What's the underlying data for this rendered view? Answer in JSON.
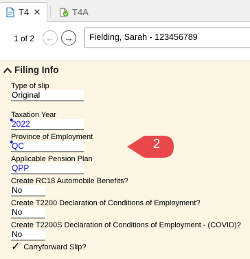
{
  "tabs": [
    {
      "label": "T4",
      "close": "✕",
      "active": true
    },
    {
      "label": "T4A",
      "active": false
    }
  ],
  "nav": {
    "pager": "1 of 2",
    "selector_value": "Fielding, Sarah - 123456789"
  },
  "panel": {
    "title": "Filing Info",
    "fields": [
      {
        "label": "Type of slip",
        "value": "Original"
      },
      {
        "label": "Taxation Year",
        "value": "2022"
      },
      {
        "label": "Province of Employment",
        "value": "QC"
      },
      {
        "label": "Applicable Pension Plan",
        "value": "QPP"
      },
      {
        "label": "Create RC18 Automobile Benefits?",
        "value": "No"
      },
      {
        "label": "Create T2200 Declaration of Conditions of Employment?",
        "value": "No"
      },
      {
        "label": "Create T2200S Declaration of Conditions of Employment - (COVID)?",
        "value": "No"
      }
    ],
    "checkbox": {
      "label": "Carryforward Slip?",
      "checked": true
    }
  },
  "callout": {
    "number": "2",
    "color": "#e8474b"
  },
  "colors": {
    "panel_bg": "#fdf6e3",
    "value_blue": "#1a1acc",
    "tab_bg": "#f0f0f0"
  }
}
